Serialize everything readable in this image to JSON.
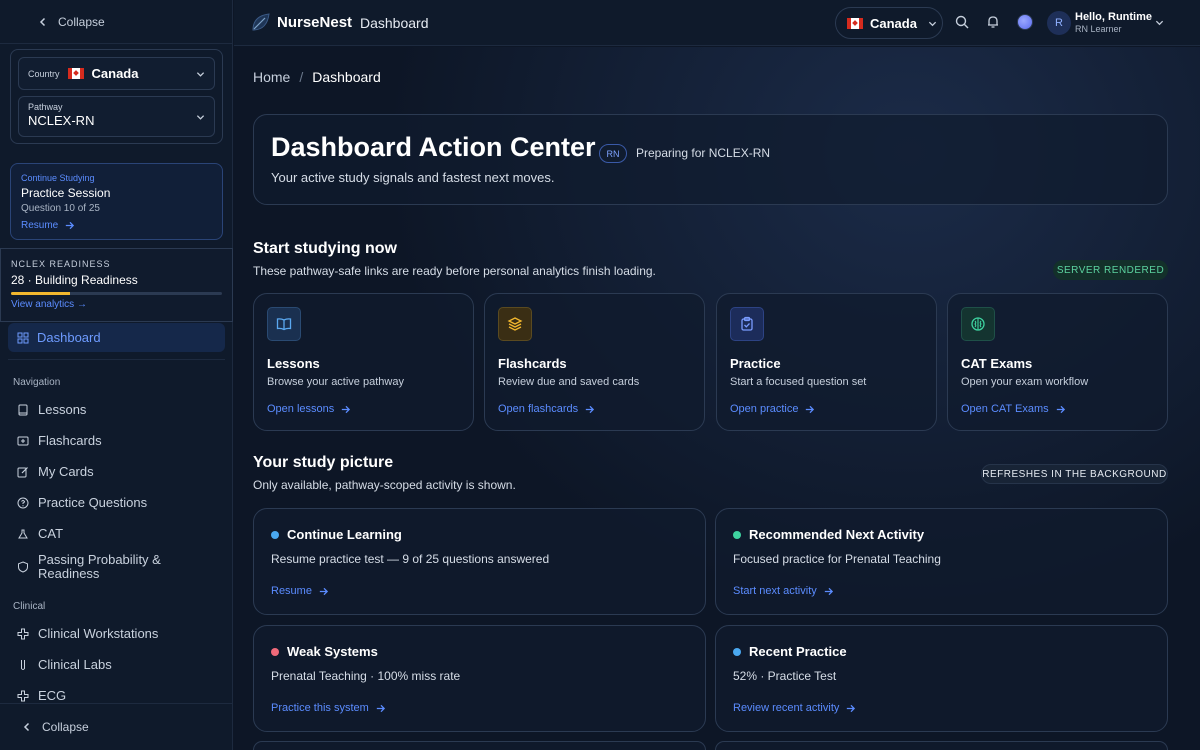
{
  "sidebar": {
    "collapse_top": "Collapse",
    "country_label": "Country",
    "country_value": "Canada",
    "pathway_label": "Pathway",
    "pathway_value": "NCLEX-RN",
    "continue": {
      "kicker": "Continue Studying",
      "title": "Practice Session",
      "subtitle": "Question 10 of 25",
      "action": "Resume"
    },
    "readiness": {
      "kicker": "NCLEX READINESS",
      "title": "28 · Building Readiness",
      "score_percent": 28,
      "action": "View analytics →"
    },
    "active_item": "Dashboard",
    "sections": {
      "navigation": "Navigation",
      "clinical": "Clinical"
    },
    "nav_items": [
      "Lessons",
      "Flashcards",
      "My Cards",
      "Practice Questions",
      "CAT",
      "Passing Probability & Readiness"
    ],
    "clinical_items": [
      "Clinical Workstations",
      "Clinical Labs",
      "ECG"
    ],
    "collapse_bottom": "Collapse"
  },
  "header": {
    "brand": "NurseNest",
    "page": "Dashboard",
    "country": "Canada",
    "avatar_initial": "R",
    "user_name": "Hello, Runtime",
    "user_role": "RN Learner"
  },
  "breadcrumb": {
    "home": "Home",
    "separator": "/",
    "current": "Dashboard"
  },
  "hero": {
    "title": "Dashboard Action Center",
    "badge": "RN",
    "preparing": "Preparing for NCLEX-RN",
    "subtitle": "Your active study signals and fastest next moves."
  },
  "start": {
    "title": "Start studying now",
    "subtitle": "These pathway-safe links are ready before personal analytics finish loading.",
    "tag": "SERVER RENDERED",
    "cards": [
      {
        "title": "Lessons",
        "desc": "Browse your active pathway",
        "action": "Open lessons",
        "icon": "book-icon"
      },
      {
        "title": "Flashcards",
        "desc": "Review due and saved cards",
        "action": "Open flashcards",
        "icon": "layers-icon"
      },
      {
        "title": "Practice",
        "desc": "Start a focused question set",
        "action": "Open practice",
        "icon": "clipboard-check-icon"
      },
      {
        "title": "CAT Exams",
        "desc": "Open your exam workflow",
        "action": "Open CAT Exams",
        "icon": "brain-icon"
      }
    ]
  },
  "picture": {
    "title": "Your study picture",
    "subtitle": "Only available, pathway-scoped activity is shown.",
    "tag": "REFRESHES IN THE BACKGROUND",
    "cards": [
      {
        "title": "Continue Learning",
        "desc": "Resume practice test — 9 of 25 questions answered",
        "action": "Resume",
        "dot": "#4aa8f0"
      },
      {
        "title": "Recommended Next Activity",
        "desc": "Focused practice for Prenatal Teaching",
        "action": "Start next activity",
        "dot": "#3ed3a0"
      },
      {
        "title": "Weak Systems",
        "desc": "Prenatal Teaching · 100% miss rate",
        "action": "Practice this system",
        "dot": "#f06a7a"
      },
      {
        "title": "Recent Practice",
        "desc": "52% · Practice Test",
        "action": "Review recent activity",
        "dot": "#4aa8f0"
      }
    ]
  },
  "colors": {
    "accent": "#5b8cff",
    "background": "#0d1626",
    "readiness_bar": "#f2b72e"
  }
}
